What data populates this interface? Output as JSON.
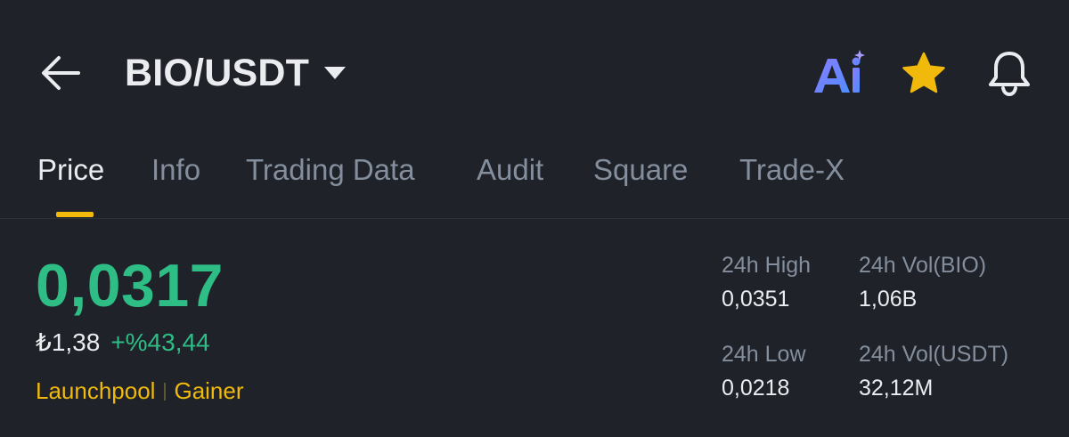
{
  "header": {
    "title": "BIO/USDT",
    "icons": {
      "back": "arrow-left-icon",
      "dropdown": "caret-down-icon",
      "ai": "ai-icon",
      "favorite": "star-icon",
      "alerts": "bell-icon"
    }
  },
  "tabs": [
    {
      "label": "Price",
      "active": true
    },
    {
      "label": "Info",
      "active": false
    },
    {
      "label": "Trading Data",
      "active": false
    },
    {
      "label": "Audit",
      "active": false
    },
    {
      "label": "Square",
      "active": false
    },
    {
      "label": "Trade-X",
      "active": false
    }
  ],
  "price": {
    "last": "0,0317",
    "fiat": "₺1,38",
    "change": "+%43,44"
  },
  "tags": [
    "Launchpool",
    "Gainer"
  ],
  "stats": {
    "high_label": "24h High",
    "high_value": "0,0351",
    "vol_base_label": "24h Vol(BIO)",
    "vol_base_value": "1,06B",
    "low_label": "24h Low",
    "low_value": "0,0218",
    "vol_quote_label": "24h Vol(USDT)",
    "vol_quote_value": "32,12M"
  },
  "colors": {
    "background": "#1f2229",
    "up": "#2ebd85",
    "accent": "#f0b90b",
    "text_primary": "#eaecef",
    "text_secondary": "#848e9c"
  }
}
